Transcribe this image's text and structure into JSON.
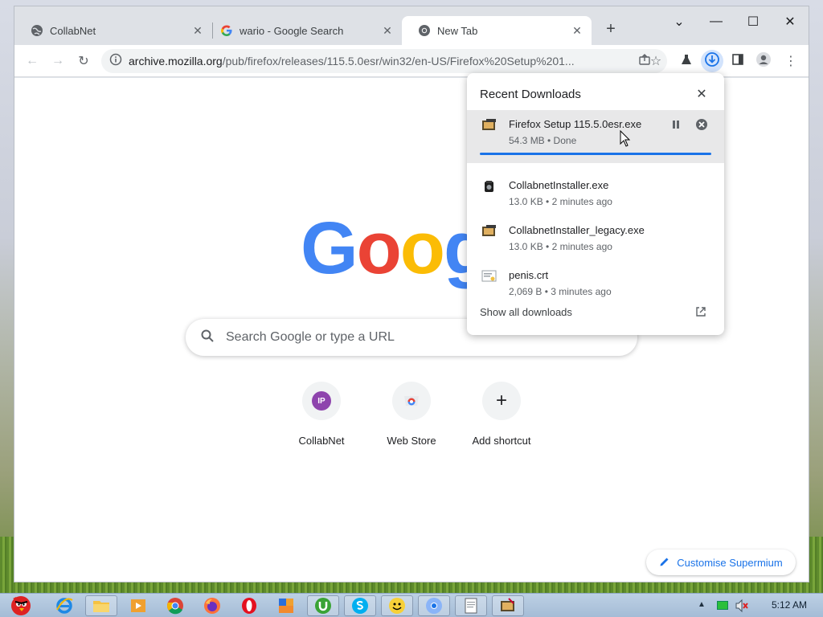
{
  "tabs": [
    {
      "title": "CollabNet",
      "icon": "globe-icon",
      "active": false
    },
    {
      "title": "wario - Google Search",
      "icon": "google-icon",
      "active": false
    },
    {
      "title": "New Tab",
      "icon": "chrome-icon",
      "active": true
    }
  ],
  "toolbar": {
    "url_host": "archive.mozilla.org",
    "url_path": "/pub/firefox/releases/115.5.0esr/win32/en-US/Firefox%20Setup%201..."
  },
  "newtab": {
    "logo_letters": [
      "G",
      "o",
      "o",
      "g"
    ],
    "logo_colors": [
      "#4285f4",
      "#ea4335",
      "#fbbc05",
      "#4285f4"
    ],
    "search_placeholder": "Search Google or type a URL",
    "shortcuts": [
      {
        "label": "CollabNet",
        "icon_text": "IP",
        "icon_color": "#8e44ad"
      },
      {
        "label": "Web Store",
        "icon": "web-store-icon"
      },
      {
        "label": "Add shortcut",
        "icon": "plus-icon"
      }
    ],
    "customise_label": "Customise Supermium"
  },
  "downloads": {
    "header": "Recent Downloads",
    "items": [
      {
        "name": "Firefox Setup 115.5.0esr.exe",
        "meta": "54.3 MB • Done",
        "icon": "installer-icon",
        "progress": 1.0
      },
      {
        "name": "CollabnetInstaller.exe",
        "meta": "13.0 KB • 2 minutes ago",
        "icon": "app-icon"
      },
      {
        "name": "CollabnetInstaller_legacy.exe",
        "meta": "13.0 KB • 2 minutes ago",
        "icon": "installer-icon"
      },
      {
        "name": "penis.crt",
        "meta": "2,069 B • 3 minutes ago",
        "icon": "certificate-icon"
      }
    ],
    "show_all": "Show all downloads"
  },
  "taskbar": {
    "clock": "5:12 AM"
  }
}
